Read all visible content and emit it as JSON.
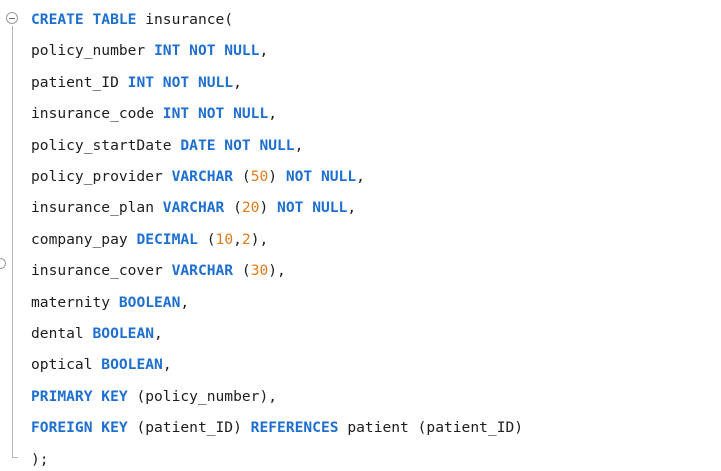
{
  "lines": [
    [
      {
        "t": "kw",
        "v": "CREATE TABLE "
      },
      {
        "t": "plain",
        "v": "insurance("
      }
    ],
    [
      {
        "t": "plain",
        "v": "policy_number "
      },
      {
        "t": "kw",
        "v": "INT NOT NULL"
      },
      {
        "t": "plain",
        "v": ","
      }
    ],
    [
      {
        "t": "plain",
        "v": "patient_ID "
      },
      {
        "t": "kw",
        "v": "INT NOT NULL"
      },
      {
        "t": "plain",
        "v": ","
      }
    ],
    [
      {
        "t": "plain",
        "v": "insurance_code "
      },
      {
        "t": "kw",
        "v": "INT NOT NULL"
      },
      {
        "t": "plain",
        "v": ","
      }
    ],
    [
      {
        "t": "plain",
        "v": "policy_startDate "
      },
      {
        "t": "kw",
        "v": "DATE NOT NULL"
      },
      {
        "t": "plain",
        "v": ","
      }
    ],
    [
      {
        "t": "plain",
        "v": "policy_provider "
      },
      {
        "t": "kw",
        "v": "VARCHAR"
      },
      {
        "t": "plain",
        "v": " ("
      },
      {
        "t": "num",
        "v": "50"
      },
      {
        "t": "plain",
        "v": ") "
      },
      {
        "t": "kw",
        "v": "NOT NULL"
      },
      {
        "t": "plain",
        "v": ","
      }
    ],
    [
      {
        "t": "plain",
        "v": "insurance_plan "
      },
      {
        "t": "kw",
        "v": "VARCHAR"
      },
      {
        "t": "plain",
        "v": " ("
      },
      {
        "t": "num",
        "v": "20"
      },
      {
        "t": "plain",
        "v": ") "
      },
      {
        "t": "kw",
        "v": "NOT NULL"
      },
      {
        "t": "plain",
        "v": ","
      }
    ],
    [
      {
        "t": "plain",
        "v": "company_pay "
      },
      {
        "t": "kw",
        "v": "DECIMAL"
      },
      {
        "t": "plain",
        "v": " ("
      },
      {
        "t": "num",
        "v": "10"
      },
      {
        "t": "plain",
        "v": ","
      },
      {
        "t": "num",
        "v": "2"
      },
      {
        "t": "plain",
        "v": "),"
      }
    ],
    [
      {
        "t": "plain",
        "v": "insurance_cover "
      },
      {
        "t": "kw",
        "v": "VARCHAR"
      },
      {
        "t": "plain",
        "v": " ("
      },
      {
        "t": "num",
        "v": "30"
      },
      {
        "t": "plain",
        "v": "),"
      }
    ],
    [
      {
        "t": "plain",
        "v": "maternity "
      },
      {
        "t": "kw",
        "v": "BOOLEAN"
      },
      {
        "t": "plain",
        "v": ","
      }
    ],
    [
      {
        "t": "plain",
        "v": "dental "
      },
      {
        "t": "kw",
        "v": "BOOLEAN"
      },
      {
        "t": "plain",
        "v": ","
      }
    ],
    [
      {
        "t": "plain",
        "v": "optical "
      },
      {
        "t": "kw",
        "v": "BOOLEAN"
      },
      {
        "t": "plain",
        "v": ","
      }
    ],
    [
      {
        "t": "kw",
        "v": "PRIMARY KEY"
      },
      {
        "t": "plain",
        "v": " (policy_number),"
      }
    ],
    [
      {
        "t": "kw",
        "v": "FOREIGN KEY"
      },
      {
        "t": "plain",
        "v": " (patient_ID) "
      },
      {
        "t": "kw",
        "v": "REFERENCES"
      },
      {
        "t": "plain",
        "v": " patient (patient_ID)"
      }
    ],
    [
      {
        "t": "plain",
        "v": ");"
      }
    ]
  ],
  "colors": {
    "keyword": "#1e6fd0",
    "number": "#e07b1c",
    "text": "#1e1e1e",
    "background": "#ffffff"
  },
  "icons": {
    "fold_toggle": "collapse-minus-icon",
    "side_marker": "breakpoint-circle-icon"
  }
}
